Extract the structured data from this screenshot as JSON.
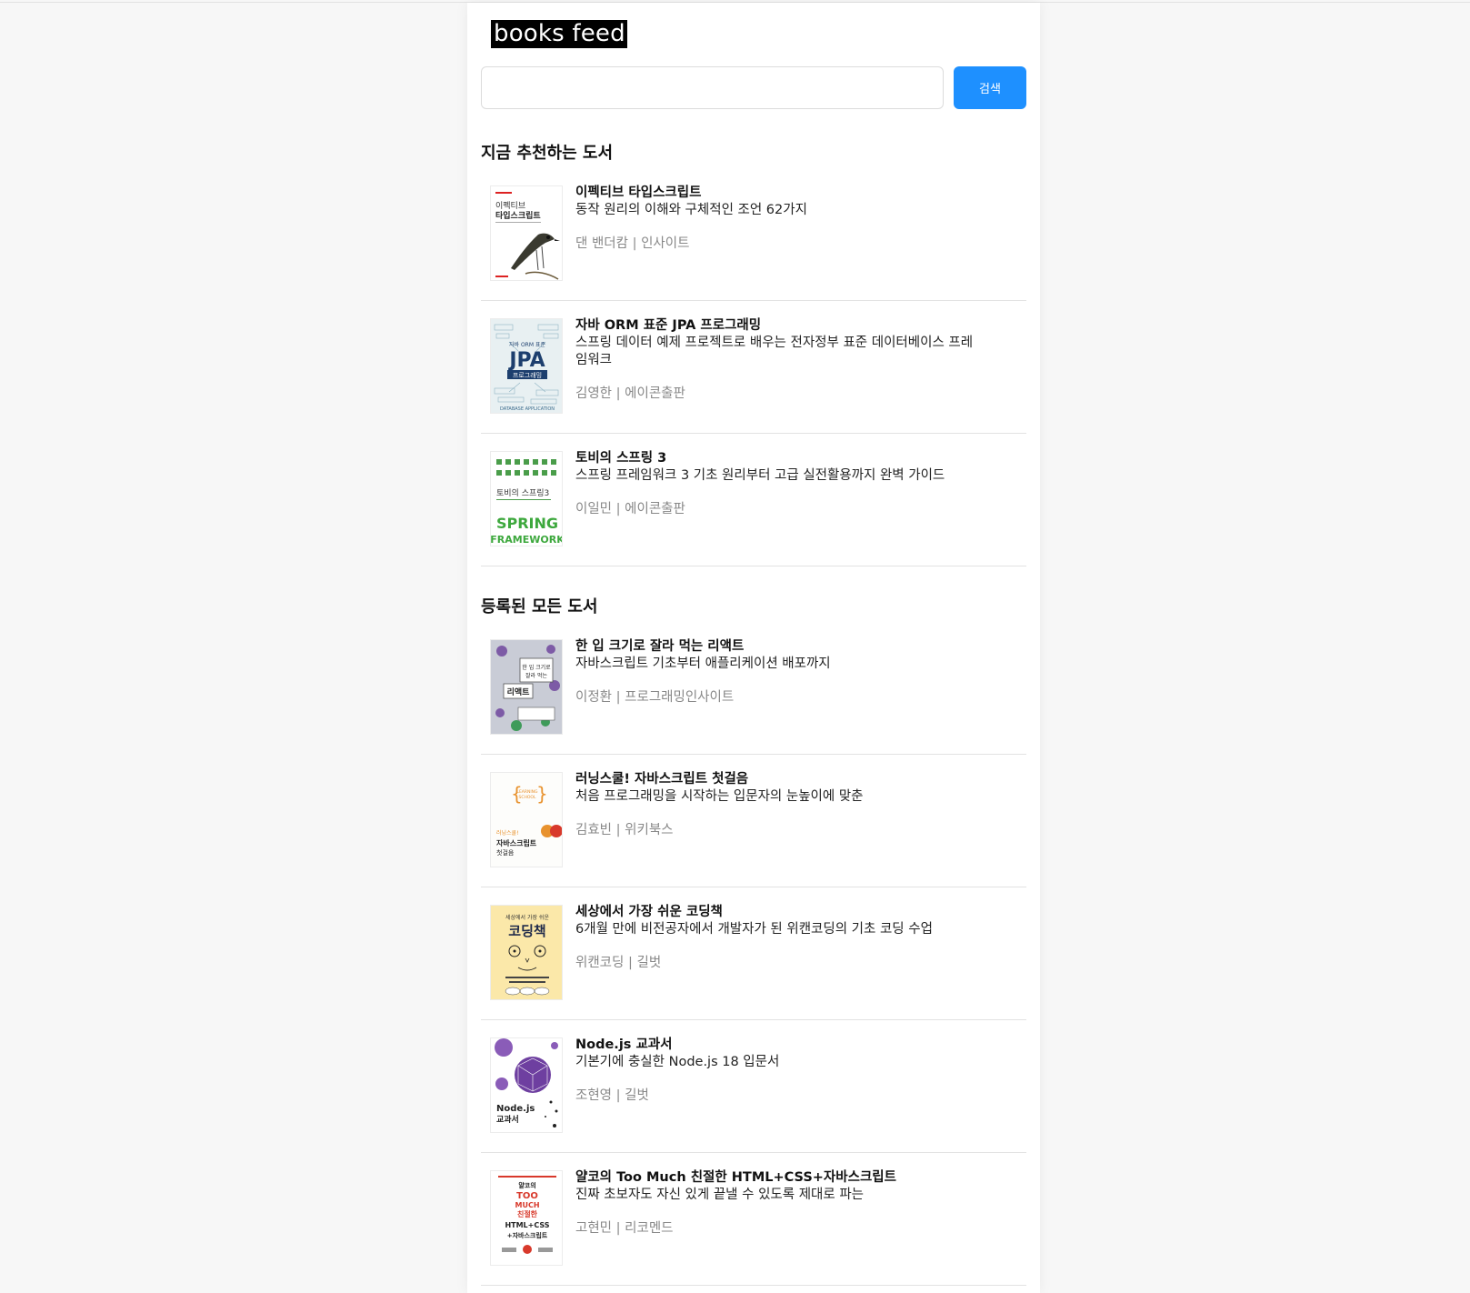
{
  "header": {
    "logo": "books feed"
  },
  "search": {
    "value": "",
    "placeholder": "",
    "button_label": "검색"
  },
  "colors": {
    "accent": "#1e90ff",
    "meta_text": "#888888",
    "divider": "#e2e2e2"
  },
  "recommended": {
    "title": "지금 추천하는 도서",
    "books": [
      {
        "title": "이펙티브 타입스크립트",
        "subtitle": "동작 원리의 이해와 구체적인 조언 62가지",
        "author": "댄 밴더캄",
        "publisher": "인사이트",
        "cover": "bird-cover-icon"
      },
      {
        "title": "자바 ORM 표준 JPA 프로그래밍",
        "subtitle": "스프링 데이터 예제 프로젝트로 배우는 전자정부 표준 데이터베이스 프레임워크",
        "author": "김영한",
        "publisher": "에이콘출판",
        "cover": "jpa-cover-icon"
      },
      {
        "title": "토비의 스프링 3",
        "subtitle": "스프링 프레임워크 3 기초 원리부터 고급 실전활용까지 완벽 가이드",
        "author": "이일민",
        "publisher": "에이콘출판",
        "cover": "spring-cover-icon"
      }
    ]
  },
  "all_books": {
    "title": "등록된 모든 도서",
    "books": [
      {
        "title": "한 입 크기로 잘라 먹는 리액트",
        "subtitle": "자바스크립트 기초부터 애플리케이션 배포까지",
        "author": "이정환",
        "publisher": "프로그래밍인사이트",
        "cover": "react-cover-icon"
      },
      {
        "title": "러닝스쿨! 자바스크립트 첫걸음",
        "subtitle": "처음 프로그래밍을 시작하는 입문자의 눈높이에 맞춘",
        "author": "김효빈",
        "publisher": "위키북스",
        "cover": "learning-school-cover-icon"
      },
      {
        "title": "세상에서 가장 쉬운 코딩책",
        "subtitle": "6개월 만에 비전공자에서 개발자가 된 위캔코딩의 기초 코딩 수업",
        "author": "위캔코딩",
        "publisher": "길벗",
        "cover": "coding-book-cover-icon"
      },
      {
        "title": "Node.js 교과서",
        "subtitle": "기본기에 충실한 Node.js 18 입문서",
        "author": "조현영",
        "publisher": "길벗",
        "cover": "nodejs-cover-icon"
      },
      {
        "title": "얄코의 Too Much 친절한 HTML+CSS+자바스크립트",
        "subtitle": "진짜 초보자도 자신 있게 끝낼 수 있도록 제대로 파는",
        "author": "고현민",
        "publisher": "리코멘드",
        "cover": "yalco-cover-icon"
      }
    ]
  }
}
